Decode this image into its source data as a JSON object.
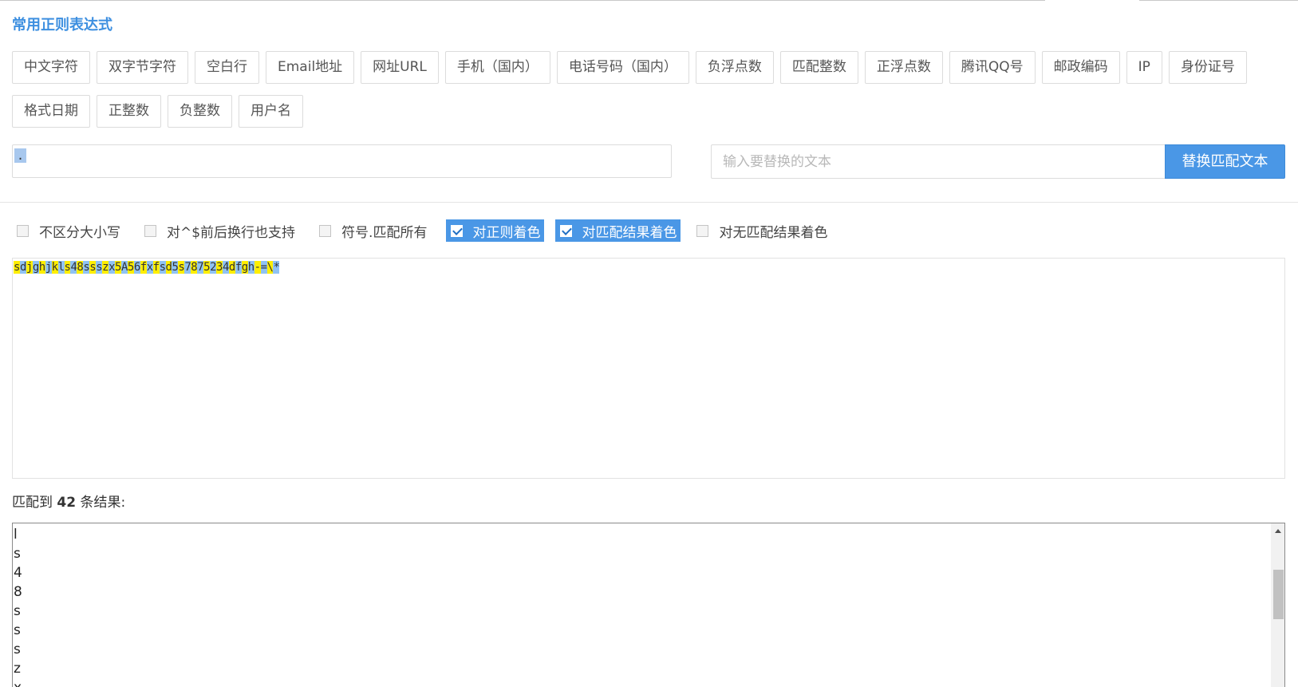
{
  "title": "常用正则表达式",
  "presets": {
    "row1": [
      {
        "name": "preset-chinese-chars",
        "label": "中文字符"
      },
      {
        "name": "preset-double-byte",
        "label": "双字节字符"
      },
      {
        "name": "preset-blank-line",
        "label": "空白行"
      },
      {
        "name": "preset-email",
        "label": "Email地址"
      },
      {
        "name": "preset-url",
        "label": "网址URL"
      },
      {
        "name": "preset-mobile",
        "label": "手机（国内）"
      },
      {
        "name": "preset-phone",
        "label": "电话号码（国内）"
      },
      {
        "name": "preset-negative-float",
        "label": "负浮点数"
      },
      {
        "name": "preset-integer",
        "label": "匹配整数"
      },
      {
        "name": "preset-positive-float",
        "label": "正浮点数"
      },
      {
        "name": "preset-qq",
        "label": "腾讯QQ号"
      },
      {
        "name": "preset-postcode",
        "label": "邮政编码"
      },
      {
        "name": "preset-ip",
        "label": "IP"
      },
      {
        "name": "preset-id-card",
        "label": "身份证号"
      }
    ],
    "row2": [
      {
        "name": "preset-date-format",
        "label": "格式日期"
      },
      {
        "name": "preset-positive-integer",
        "label": "正整数"
      },
      {
        "name": "preset-negative-integer",
        "label": "负整数"
      },
      {
        "name": "preset-username",
        "label": "用户名"
      }
    ]
  },
  "regex_input": {
    "value": "."
  },
  "replace": {
    "placeholder": "输入要替换的文本",
    "button_label": "替换匹配文本"
  },
  "options": [
    {
      "name": "option-ignore-case",
      "label": "不区分大小写",
      "checked": false
    },
    {
      "name": "option-multiline",
      "label": "对^$前后换行也支持",
      "checked": false
    },
    {
      "name": "option-dotall",
      "label": "符号.匹配所有",
      "checked": false
    },
    {
      "name": "option-color-regex",
      "label": "对正则着色",
      "checked": true
    },
    {
      "name": "option-color-matches",
      "label": "对匹配结果着色",
      "checked": true
    },
    {
      "name": "option-color-nonmatches",
      "label": "对无匹配结果着色",
      "checked": false
    }
  ],
  "source_text": "sdjghjkls48ssszx5A56fxfsd5s7875234dfgh-=\\*",
  "highlight_colors": {
    "a": "#ffee00",
    "b": "#8fc2f4"
  },
  "result_summary": {
    "prefix": "匹配到 ",
    "count": "42",
    "suffix": " 条结果:"
  },
  "results": [
    "l",
    "s",
    "4",
    "8",
    "s",
    "s",
    "s",
    "z",
    "x"
  ]
}
